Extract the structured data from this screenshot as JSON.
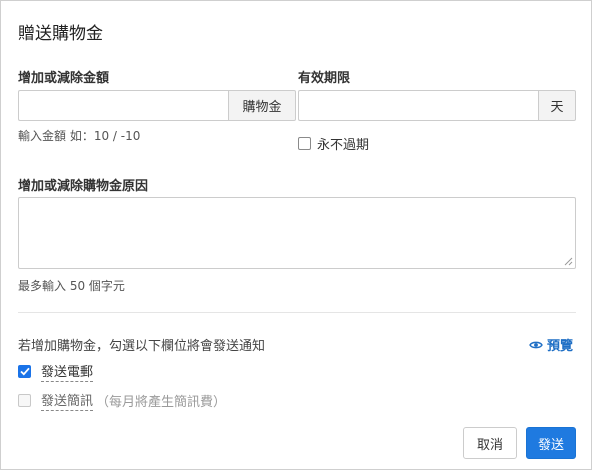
{
  "dialog": {
    "title": "贈送購物金",
    "amount": {
      "label": "增加或減除金額",
      "value": "",
      "addon": "購物金",
      "hint": "輸入金額 如：10 / -10"
    },
    "expiry": {
      "label": "有效期限",
      "value": "",
      "addon": "天",
      "never_expire_label": "永不過期",
      "never_expire_checked": false
    },
    "reason": {
      "label": "增加或減除購物金原因",
      "value": "",
      "hint": "最多輸入 50 個字元"
    },
    "notify": {
      "text": "若增加購物金，勾選以下欄位將會發送通知",
      "preview_label": "預覽",
      "preview_icon": "eye-icon",
      "email_label": "發送電郵",
      "email_checked": true,
      "sms_label": "發送簡訊",
      "sms_note": "（每月將產生簡訊費）",
      "sms_checked": false,
      "sms_disabled": true
    },
    "buttons": {
      "cancel": "取消",
      "send": "發送"
    },
    "colors": {
      "primary": "#1f7ae0",
      "link": "#1f6fc5",
      "border": "#cccccc"
    }
  }
}
